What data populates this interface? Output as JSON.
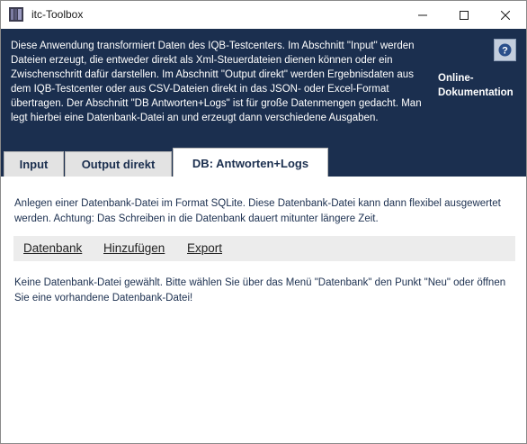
{
  "window": {
    "title": "itc-Toolbox"
  },
  "header": {
    "description": "Diese Anwendung transformiert Daten des IQB-Testcenters. Im Abschnitt \"Input\" werden Dateien erzeugt, die entweder direkt als Xml-Steuerdateien dienen können oder ein Zwischenschritt dafür darstellen. Im Abschnitt \"Output direkt\" werden Ergebnisdaten aus dem IQB-Testcenter oder aus CSV-Dateien direkt in das JSON- oder Excel-Format übertragen. Der Abschnitt \"DB Antworten+Logs\" ist für große Datenmengen gedacht. Man legt hierbei eine Datenbank-Datei an und erzeugt dann verschiedene Ausgaben.",
    "help_icon": "help-question-icon",
    "online_doc_label": "Online-Dokumentation"
  },
  "tabs": [
    {
      "label": "Input"
    },
    {
      "label": "Output direkt"
    },
    {
      "label": "DB: Antworten+Logs",
      "active": true
    }
  ],
  "content": {
    "description": "Anlegen einer Datenbank-Datei im Format SQLite. Diese Datenbank-Datei kann dann flexibel ausgewertet werden. Achtung: Das Schreiben in die Datenbank dauert mitunter längere Zeit.",
    "menu": [
      {
        "label": "Datenbank"
      },
      {
        "label": "Hinzufügen"
      },
      {
        "label": "Export"
      }
    ],
    "empty_message": "Keine Datenbank-Datei gewählt. Bitte wählen Sie über das Menü \"Datenbank\" den Punkt \"Neu\" oder öffnen Sie eine vorhandene Datenbank-Datei!"
  },
  "colors": {
    "header_bg": "#1b2f4f",
    "tab_text": "#1b2f4f",
    "menubar_bg": "#ececec"
  }
}
